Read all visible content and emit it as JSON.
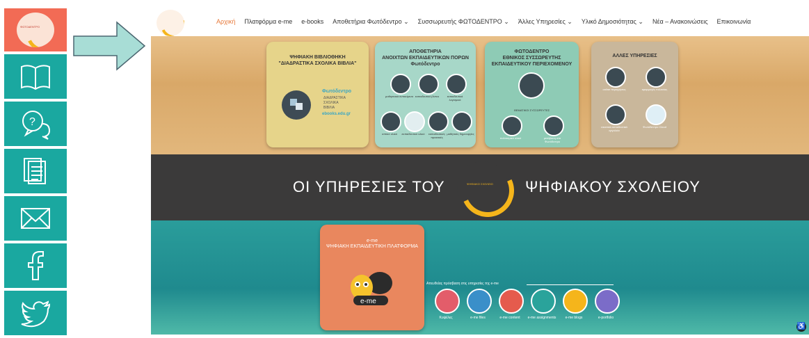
{
  "sidebar": {
    "items": [
      {
        "name": "photodentro-logo",
        "icon": "logo"
      },
      {
        "name": "open-book-icon",
        "icon": "book"
      },
      {
        "name": "help-chat-icon",
        "icon": "question-bubbles"
      },
      {
        "name": "document-icon",
        "icon": "document"
      },
      {
        "name": "mail-icon",
        "icon": "envelope"
      },
      {
        "name": "facebook-icon",
        "icon": "facebook"
      },
      {
        "name": "twitter-icon",
        "icon": "twitter"
      }
    ],
    "colors": {
      "logo_bg": "#f26b55",
      "teal": "#1aa8a0"
    }
  },
  "nav": {
    "menu": [
      "Αρχική",
      "Πλατφόρμα e-me",
      "e-books",
      "Αποθετήρια Φωτόδεντρο ⌄",
      "Συσσωρευτής ΦΩΤΟΔΕΝΤΡΟ ⌄",
      "Άλλες Υπηρεσίες ⌄",
      "Υλικό Δημοσιότητας ⌄",
      "Νέα – Ανακοινώσεις",
      "Επικοινωνία"
    ],
    "active_color": "#e7793a"
  },
  "cards": {
    "c1": {
      "title": "ΨΗΦΙΑΚΗ ΒΙΒΛΙΟΘΗΚΗ\n\"ΔΙΑΔΡΑΣΤΙΚΑ ΣΧΟΛΙΚΑ ΒΙΒΛΙΑ\"",
      "brand": "Φωτόδεντρο",
      "sub1": "ΔΙΑΔΡΑΣΤΙΚΑ",
      "sub2": "ΣΧΟΛΙΚΑ",
      "sub3": "ΒΙΒΛΙΑ",
      "url": "ebooks.edu.gr"
    },
    "c2": {
      "title": "ΑΠΟΘΕΤΗΡΙΑ\nΑΝΟΙΧΤΩΝ ΕΚΠΑΙΔΕΥΤΙΚΩΝ ΠΟΡΩΝ\nΦωτόδεντρο",
      "items": [
        "μαθησιακά αντικείμενα",
        "εκπαιδευτικό βίντεο",
        "εκπαιδευτικά λογισμικά",
        "οπτικό υλικό",
        "εκπαιδευτικό υλικό",
        "εκπαιδευτικές πρακτικές",
        "μαθητικές δημιουργίες"
      ]
    },
    "c3": {
      "title": "ΦΩΤΟΔΕΝΤΡΟ\nΕΘΝΙΚΟΣ ΣΥΣΣΩΡΕΥΤΗΣ\nΕΚΠΑΙΔΕΥΤΙΚΟΥ ΠΕΡΙΕΧΟΜΕΝΟΥ",
      "sub": "ΘΕΜΑΤΙΚΟΙ ΣΥΣΣΩΡΕΥΤΕΣ",
      "items": [
        "πολιτισμικό υλικό",
        "μετάβαση στο Φωτόδεντρο"
      ]
    },
    "c4": {
      "title": "ΑΛΛΕΣ ΥΠΗΡΕΣΙΕΣ",
      "items": [
        "online περιηγήσεις",
        "εφαρμογές πολιτείας",
        "εικονικά εκπαιδευτικά εργαλεία",
        "Φωτόδεντρο Cloud"
      ]
    }
  },
  "band": {
    "left": "ΟΙ ΥΠΗΡΕΣΙΕΣ ΤΟΥ",
    "right": "ΨΗΦΙΑΚΟΥ ΣΧΟΛΕΙΟΥ"
  },
  "eme": {
    "title_top": "e-me",
    "title": "ΨΗΦΙΑΚΗ ΕΚΠΑΙΔΕΥΤΙΚΗ ΠΛΑΤΦΟΡΜΑ",
    "logo_text": "e-me",
    "label": "Απευθείας πρόσβαση στις υπηρεσίες της e-me",
    "services": [
      {
        "label": "Κυψέλες",
        "color": "#e35d6a"
      },
      {
        "label": "e-me files",
        "color": "#3a8fc9"
      },
      {
        "label": "e-me content",
        "color": "#e55b4d"
      },
      {
        "label": "e-me assignments",
        "color": "#2aa39b"
      },
      {
        "label": "e-me blogs",
        "color": "#f5b51b"
      },
      {
        "label": "e-portfolio",
        "color": "#7b6cc8"
      }
    ]
  },
  "a11y": {
    "icon": "accessibility-icon",
    "glyph": "♿"
  }
}
